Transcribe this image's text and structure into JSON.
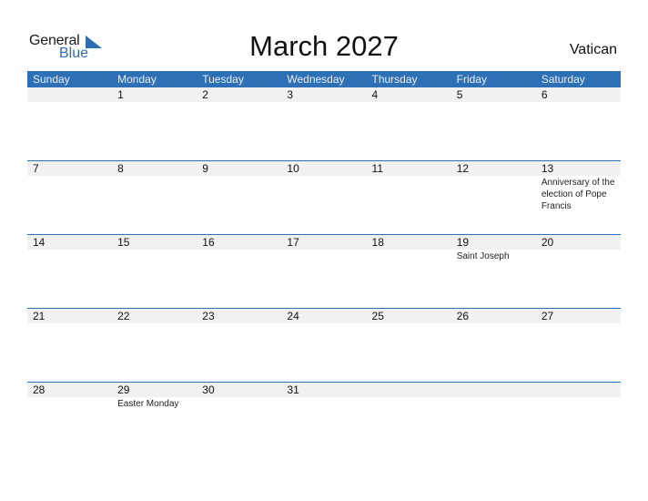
{
  "logo": {
    "line1": "General",
    "line2": "Blue"
  },
  "title": "March 2027",
  "country": "Vatican",
  "colors": {
    "accent": "#2e70b5",
    "date_strip": "#f1f1f1"
  },
  "weekdays": [
    "Sunday",
    "Monday",
    "Tuesday",
    "Wednesday",
    "Thursday",
    "Friday",
    "Saturday"
  ],
  "weeks": [
    [
      {
        "day": "",
        "event": ""
      },
      {
        "day": "1",
        "event": ""
      },
      {
        "day": "2",
        "event": ""
      },
      {
        "day": "3",
        "event": ""
      },
      {
        "day": "4",
        "event": ""
      },
      {
        "day": "5",
        "event": ""
      },
      {
        "day": "6",
        "event": ""
      }
    ],
    [
      {
        "day": "7",
        "event": ""
      },
      {
        "day": "8",
        "event": ""
      },
      {
        "day": "9",
        "event": ""
      },
      {
        "day": "10",
        "event": ""
      },
      {
        "day": "11",
        "event": ""
      },
      {
        "day": "12",
        "event": ""
      },
      {
        "day": "13",
        "event": "Anniversary of the election of Pope Francis"
      }
    ],
    [
      {
        "day": "14",
        "event": ""
      },
      {
        "day": "15",
        "event": ""
      },
      {
        "day": "16",
        "event": ""
      },
      {
        "day": "17",
        "event": ""
      },
      {
        "day": "18",
        "event": ""
      },
      {
        "day": "19",
        "event": "Saint Joseph"
      },
      {
        "day": "20",
        "event": ""
      }
    ],
    [
      {
        "day": "21",
        "event": ""
      },
      {
        "day": "22",
        "event": ""
      },
      {
        "day": "23",
        "event": ""
      },
      {
        "day": "24",
        "event": ""
      },
      {
        "day": "25",
        "event": ""
      },
      {
        "day": "26",
        "event": ""
      },
      {
        "day": "27",
        "event": ""
      }
    ],
    [
      {
        "day": "28",
        "event": ""
      },
      {
        "day": "29",
        "event": "Easter Monday"
      },
      {
        "day": "30",
        "event": ""
      },
      {
        "day": "31",
        "event": ""
      },
      {
        "day": "",
        "event": ""
      },
      {
        "day": "",
        "event": ""
      },
      {
        "day": "",
        "event": ""
      }
    ]
  ]
}
